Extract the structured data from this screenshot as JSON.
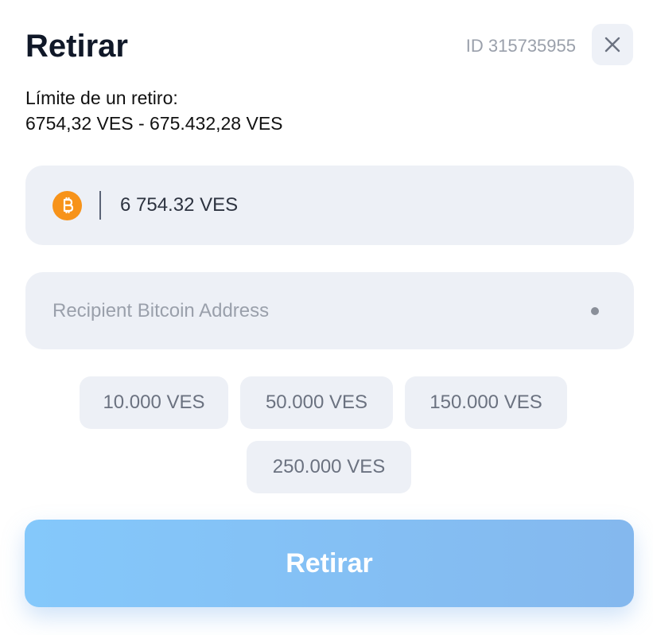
{
  "header": {
    "title": "Retirar",
    "user_id": "ID 315735955",
    "close_icon": "close-icon"
  },
  "limit": {
    "label": "Límite de un retiro:",
    "range": "6754,32 VES - 675.432,28 VES"
  },
  "amount_field": {
    "currency_icon": "bitcoin-icon",
    "value": "6 754.32 VES"
  },
  "address_field": {
    "placeholder": "Recipient Bitcoin Address",
    "value": ""
  },
  "quick_amounts": [
    "10.000 VES",
    "50.000 VES",
    "150.000 VES",
    "250.000 VES"
  ],
  "submit": {
    "label": "Retirar"
  },
  "colors": {
    "bitcoin": "#f7931a",
    "button_start": "#84c8fb",
    "button_end": "#84b8ee",
    "field_bg": "#edf0f6"
  }
}
